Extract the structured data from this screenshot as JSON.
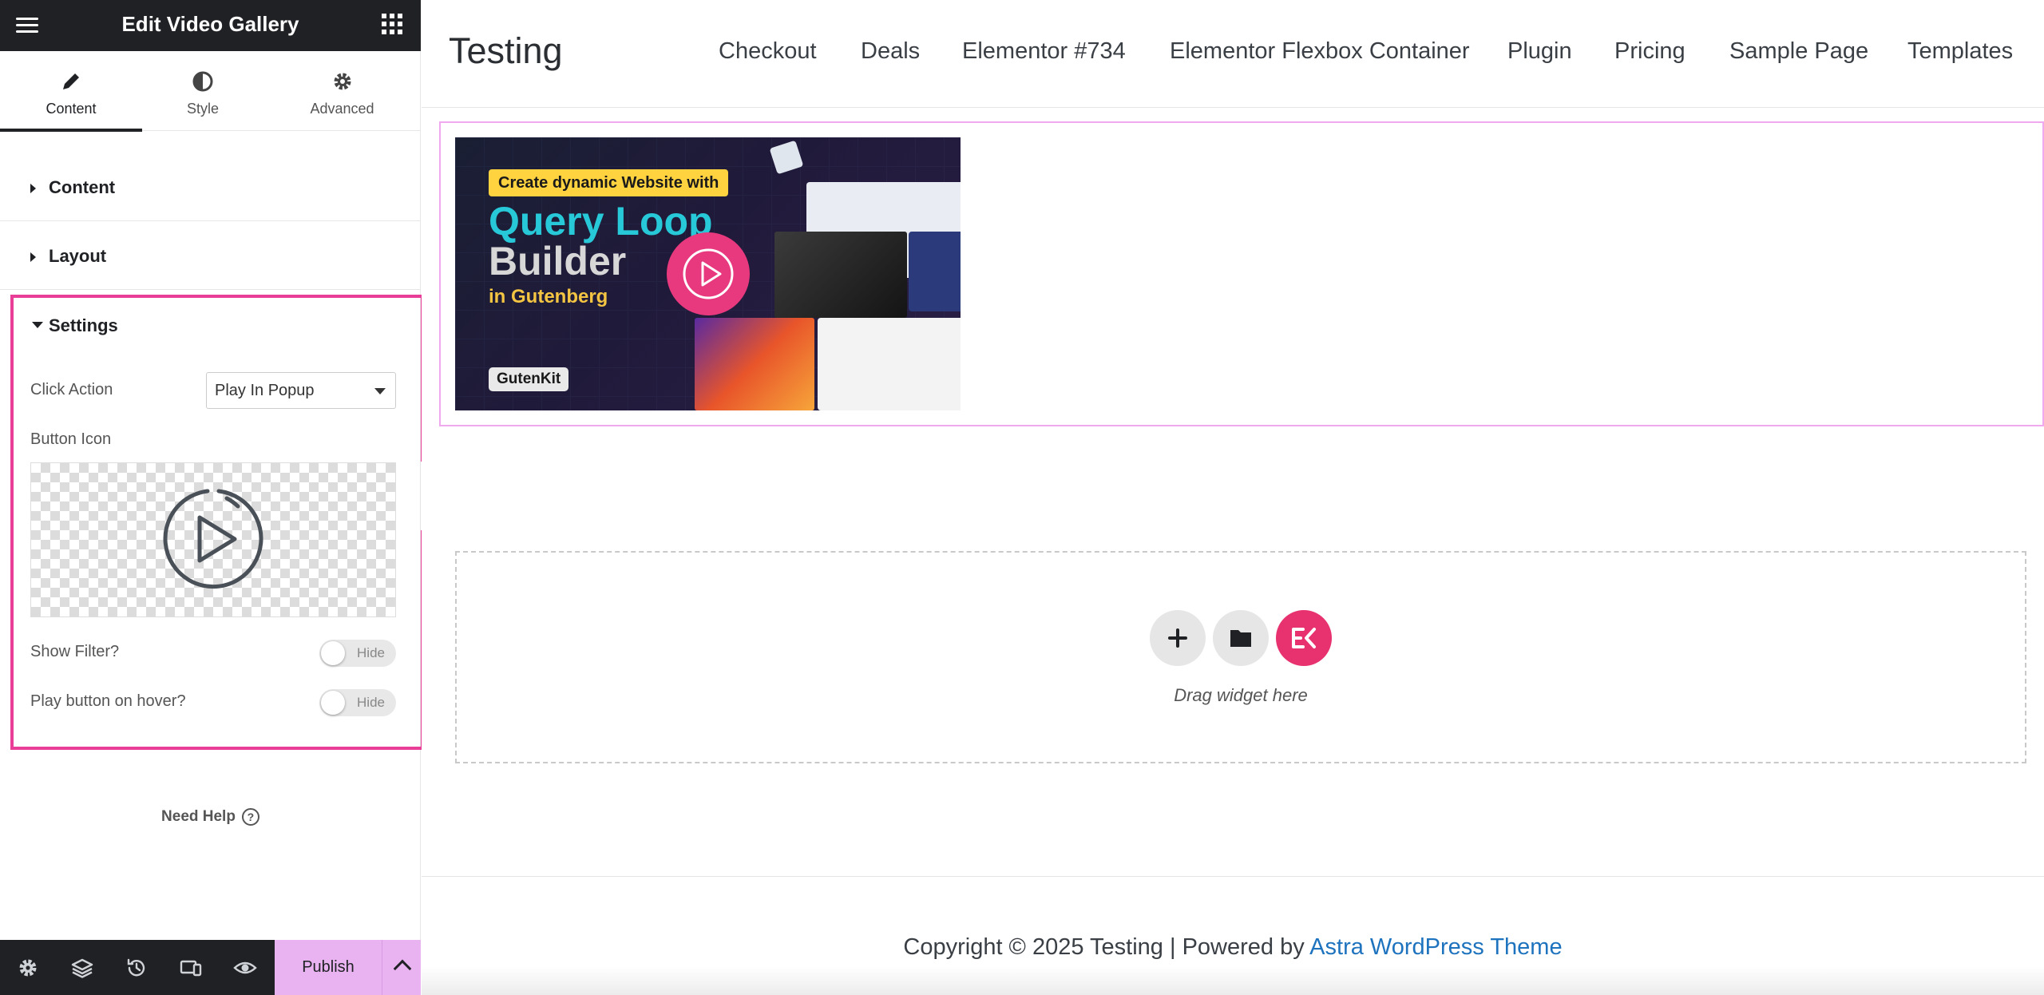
{
  "panel": {
    "title": "Edit Video Gallery",
    "tabs": [
      {
        "label": "Content",
        "icon": "pencil-icon"
      },
      {
        "label": "Style",
        "icon": "half-circle-icon"
      },
      {
        "label": "Advanced",
        "icon": "gear-icon"
      }
    ],
    "sections": {
      "content": "Content",
      "layout": "Layout",
      "settings": "Settings"
    },
    "settings": {
      "click_action_label": "Click Action",
      "click_action_value": "Play In Popup",
      "button_icon_label": "Button Icon",
      "show_filter_label": "Show Filter?",
      "show_filter_value": "Hide",
      "play_hover_label": "Play button on hover?",
      "play_hover_value": "Hide"
    },
    "need_help": "Need Help",
    "footer": {
      "publish": "Publish",
      "icons": [
        "gear-icon",
        "layers-icon",
        "history-icon",
        "responsive-icon",
        "eye-icon"
      ]
    }
  },
  "site": {
    "title": "Testing",
    "nav": [
      "Checkout",
      "Deals",
      "Elementor #734",
      "Elementor Flexbox Container",
      "Plugin",
      "Pricing",
      "Sample Page",
      "Templates"
    ],
    "thumbnail": {
      "badge": "Create dynamic Website with",
      "headline1": "Query Loop",
      "headline2": "Builder",
      "headline3": "in Gutenberg",
      "brand": "GutenKit"
    },
    "drop_text": "Drag widget here",
    "footer": {
      "copyright": "Copyright © 2025 Testing | Powered by ",
      "link": "Astra WordPress Theme"
    }
  },
  "colors": {
    "accent": "#e83e97",
    "publish_bg": "#e8b3f0",
    "dark": "#1f2124",
    "link": "#1e73be",
    "play": "#e8397e"
  }
}
